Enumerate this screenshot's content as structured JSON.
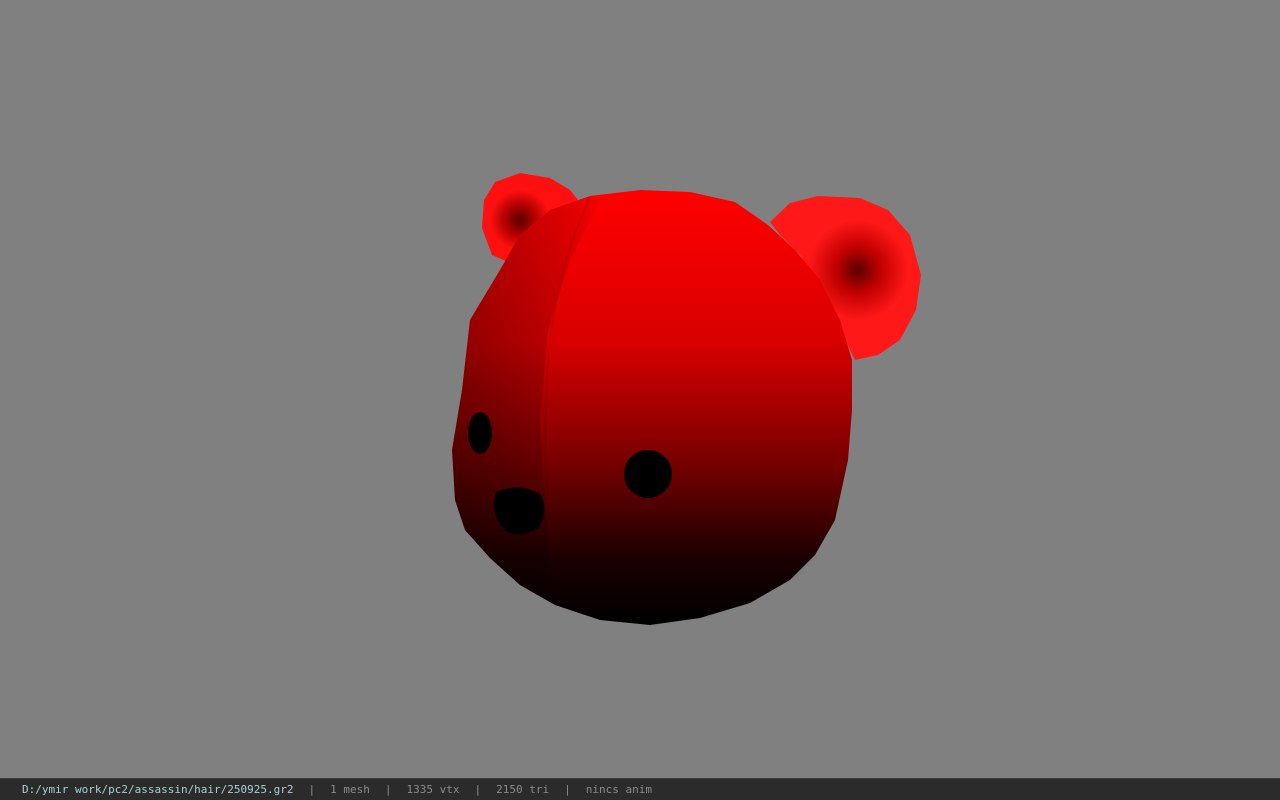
{
  "viewer": {
    "background_color": "#808080",
    "model_color": "#ff0000",
    "model": "bear-head"
  },
  "status": {
    "file_path": "D:/ymir work/pc2/assassin/hair/250925.gr2",
    "separator": "|",
    "mesh_count": "1 mesh",
    "vertex_count": "1335 vtx",
    "triangle_count": "2150 tri",
    "animation": "nincs anim"
  }
}
